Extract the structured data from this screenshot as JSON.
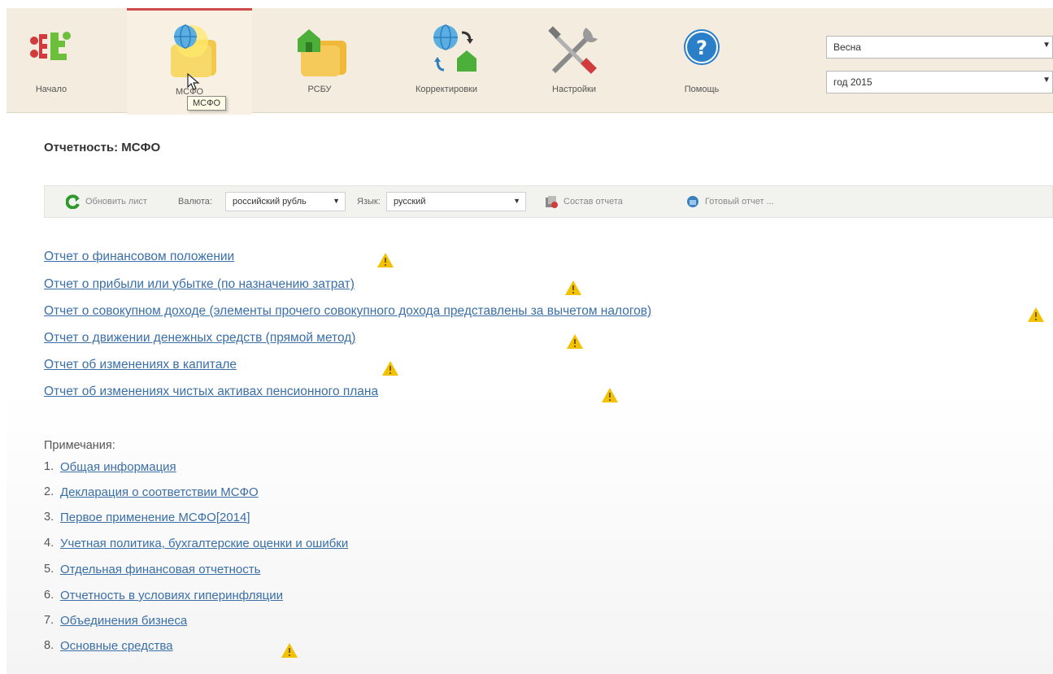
{
  "toolbar": {
    "buttons": [
      {
        "label": "Начало",
        "icon": "logo-icon"
      },
      {
        "label": "МСФО",
        "icon": "globe-folder-icon"
      },
      {
        "label": "РСБУ",
        "icon": "house-folder-icon"
      },
      {
        "label": "Корректировки",
        "icon": "globe-house-arrows-icon"
      },
      {
        "label": "Настройки",
        "icon": "tools-icon"
      },
      {
        "label": "Помощь",
        "icon": "help-icon"
      }
    ],
    "tooltip": "МСФО",
    "period_select": "Весна",
    "year_select": "год 2015"
  },
  "report": {
    "title": "Отчетность: МСФО",
    "toolbar": {
      "refresh_label": "Обновить лист",
      "currency_label": "Валюта:",
      "currency_value": "российский рубль",
      "language_label": "Язык:",
      "language_value": "русский",
      "composition_label": "Состав отчета",
      "ready_label": "Готовый отчет ..."
    },
    "statements": [
      "Отчет о финансовом положении",
      "Отчет о прибыли или убытке (по назначению затрат)",
      "Отчет о совокупном доходе (элементы прочего совокупного дохода представлены за вычетом налогов)",
      "Отчет о движении денежных средств (прямой метод)",
      "Отчет об изменениях в капитале",
      "Отчет об изменениях чистых активах пенсионного плана"
    ],
    "notes_title": "Примечания:",
    "notes": [
      {
        "num": "1.",
        "label": "Общая информация"
      },
      {
        "num": "2.",
        "label": "Декларация о соответствии МСФО"
      },
      {
        "num": "3.",
        "label": "Первое применение МСФО[2014]"
      },
      {
        "num": "4.",
        "label": "Учетная политика, бухгалтерские оценки и ошибки"
      },
      {
        "num": "5.",
        "label": "Отдельная финансовая отчетность"
      },
      {
        "num": "6.",
        "label": "Отчетность в условиях гиперинфляции"
      },
      {
        "num": "7.",
        "label": "Объединения бизнеса"
      },
      {
        "num": "8.",
        "label": "Основные средства"
      }
    ]
  },
  "colors": {
    "link": "#3a6fa8",
    "warning": "#f2c200",
    "toolbar_bg": "#f3ecdf",
    "active_tab_border": "#cc4b4b"
  }
}
